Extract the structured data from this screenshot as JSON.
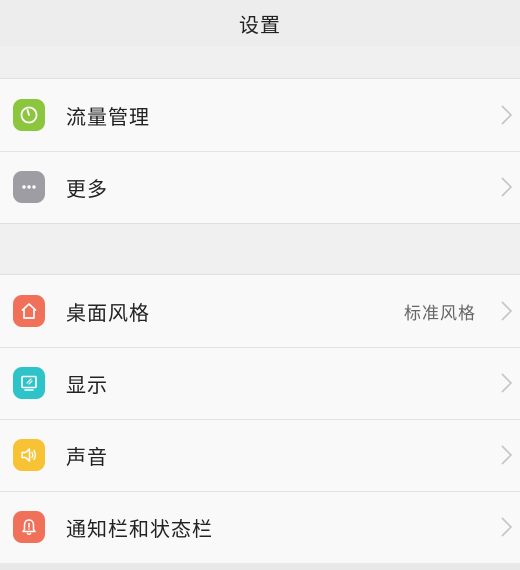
{
  "header": {
    "title": "设置"
  },
  "section1": {
    "items": [
      {
        "label": "流量管理",
        "icon": "data-usage-gauge-icon",
        "color": "#8cc63e"
      },
      {
        "label": "更多",
        "icon": "more-dots-icon",
        "color": "#9d9da3"
      }
    ]
  },
  "section2": {
    "items": [
      {
        "label": "桌面风格",
        "value": "标准风格",
        "icon": "home-icon",
        "color": "#f0705a"
      },
      {
        "label": "显示",
        "icon": "display-icon",
        "color": "#2ec3c8"
      },
      {
        "label": "声音",
        "icon": "speaker-icon",
        "color": "#f7c234"
      },
      {
        "label": "通知栏和状态栏",
        "icon": "bell-icon",
        "color": "#f0705a"
      }
    ]
  }
}
